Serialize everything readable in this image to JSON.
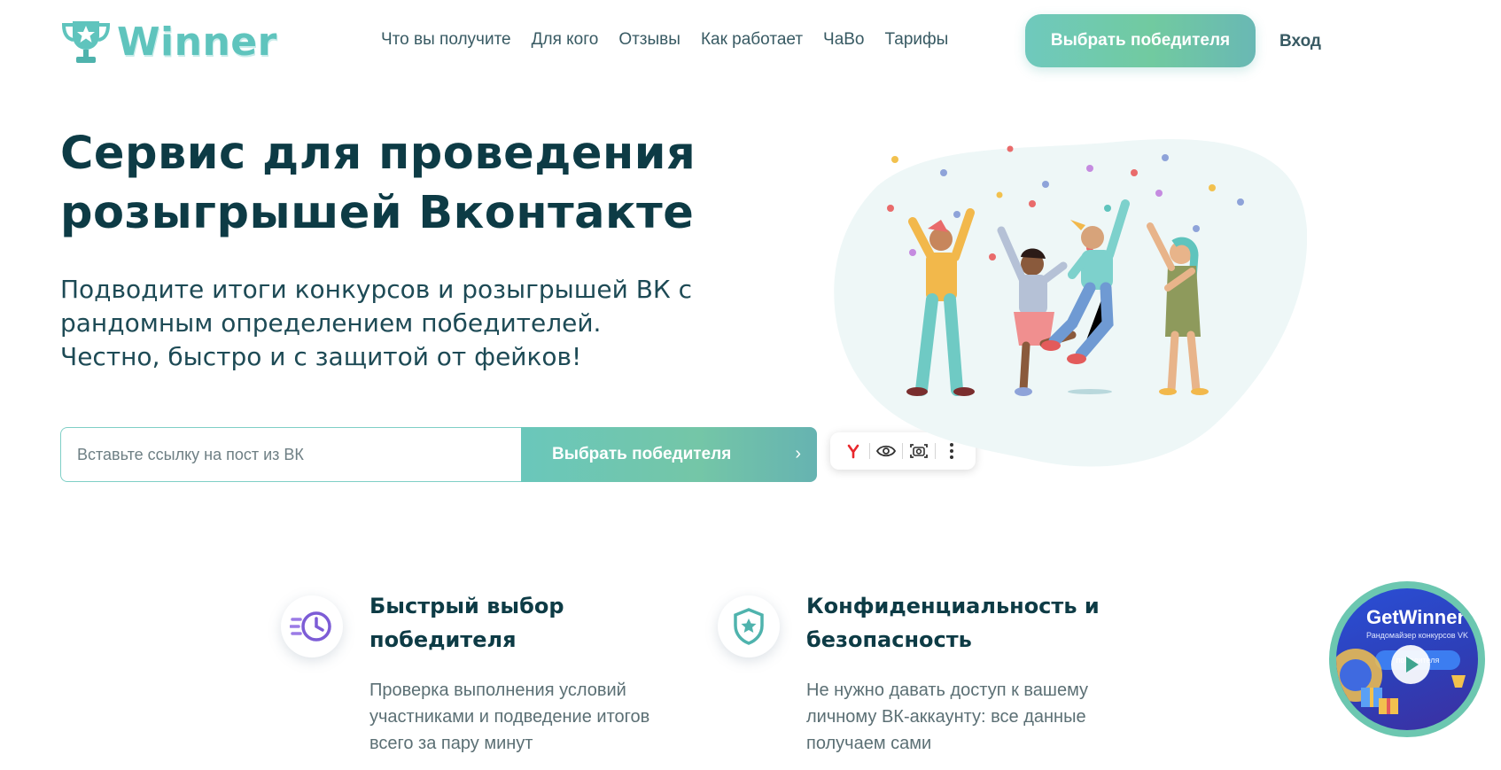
{
  "header": {
    "logo_text": "Winner",
    "nav": [
      "Что вы получите",
      "Для кого",
      "Отзывы",
      "Как работает",
      "ЧаВо",
      "Тарифы"
    ],
    "cta_label": "Выбрать победителя",
    "login_label": "Вход"
  },
  "hero": {
    "title": "Сервис для проведения розыгрышей Вконтакте",
    "subtitle_lines": [
      "Подводите итоги конкурсов и розыгрышей ВК с",
      "рандомным определением победителей.",
      "Честно, быстро и с защитой от фейков!"
    ],
    "input_placeholder": "Вставьте ссылку на пост из ВК",
    "button_label": "Выбрать победителя",
    "button_chevron": "›"
  },
  "features": [
    {
      "title_lines": [
        "Быстрый выбор",
        "победителя"
      ],
      "text_lines": [
        "Проверка выполнения условий",
        "участниками и подведение итогов",
        "всего за пару минут"
      ],
      "icon": "clock-fast-icon"
    },
    {
      "title_lines": [
        "Конфиденциальность и",
        "безопасность"
      ],
      "text_lines": [
        "Не нужно давать доступ к вашему",
        "личному ВК-аккаунту: все данные",
        "получаем сами"
      ],
      "icon": "shield-star-icon"
    }
  ],
  "video": {
    "title": "GetWinner",
    "subtitle": "Рандомайзер конкурсов VK",
    "pill": "победителя"
  },
  "colors": {
    "accent": "#6fc9bd",
    "heading": "#0d3b45",
    "text": "#385a63",
    "blob": "#eef7f7"
  }
}
